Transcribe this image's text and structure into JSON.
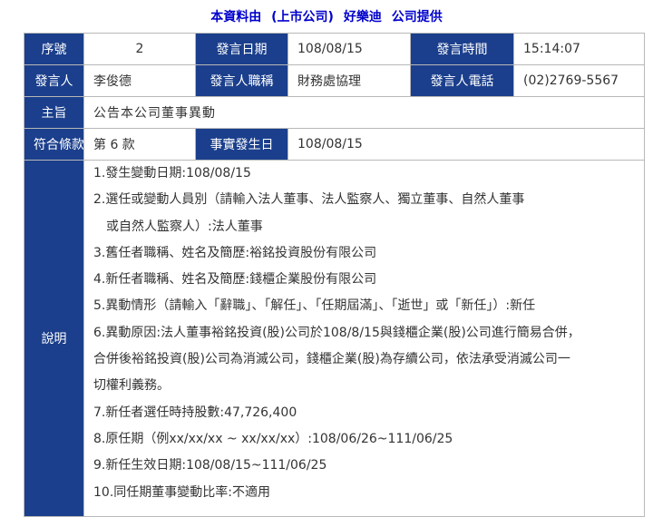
{
  "header": {
    "prefix": "本資料由",
    "company_type": "(上市公司)",
    "company_name": "好樂迪",
    "suffix": "公司提供"
  },
  "row1": {
    "seq_label": "序號",
    "seq_value": "2",
    "date_label": "發言日期",
    "date_value": "108/08/15",
    "time_label": "發言時間",
    "time_value": "15:14:07"
  },
  "row2": {
    "speaker_label": "發言人",
    "speaker_value": "李俊德",
    "title_label": "發言人職稱",
    "title_value": "財務處協理",
    "phone_label": "發言人電話",
    "phone_value": "(02)2769-5567"
  },
  "row3": {
    "subject_label": "主旨",
    "subject_value": "公告本公司董事異動"
  },
  "row4": {
    "clause_label": "符合條款",
    "clause_value": "第 6 款",
    "event_date_label": "事實發生日",
    "event_date_value": "108/08/15"
  },
  "description": {
    "label": "說明",
    "lines": [
      {
        "text": "1.發生變動日期:108/08/15",
        "indent": false
      },
      {
        "text": "2.選任或變動人員別（請輸入法人董事、法人監察人、獨立董事、自然人董事",
        "indent": false
      },
      {
        "text": "或自然人監察人）:法人董事",
        "indent": true
      },
      {
        "text": "3.舊任者職稱、姓名及簡歷:裕銘投資股份有限公司",
        "indent": false
      },
      {
        "text": "4.新任者職稱、姓名及簡歷:錢櫃企業股份有限公司",
        "indent": false
      },
      {
        "text": "5.異動情形（請輸入「辭職」、「解任」、「任期屆滿」、「逝世」或「新任」）:新任",
        "indent": false
      },
      {
        "text": "6.異動原因:法人董事裕銘投資(股)公司於108/8/15與錢櫃企業(股)公司進行簡易合併，",
        "indent": false
      },
      {
        "text": "合併後裕銘投資(股)公司為消滅公司，錢櫃企業(股)為存續公司，依法承受消滅公司一",
        "indent": false
      },
      {
        "text": "切權利義務。",
        "indent": false
      },
      {
        "text": "7.新任者選任時持股數:47,726,400",
        "indent": false
      },
      {
        "text": "8.原任期（例xx/xx/xx ~ xx/xx/xx）:108/06/26~111/06/25",
        "indent": false
      },
      {
        "text": "9.新任生效日期:108/08/15~111/06/25",
        "indent": false
      },
      {
        "text": "10.同任期董事變動比率:不適用",
        "indent": false
      }
    ]
  }
}
